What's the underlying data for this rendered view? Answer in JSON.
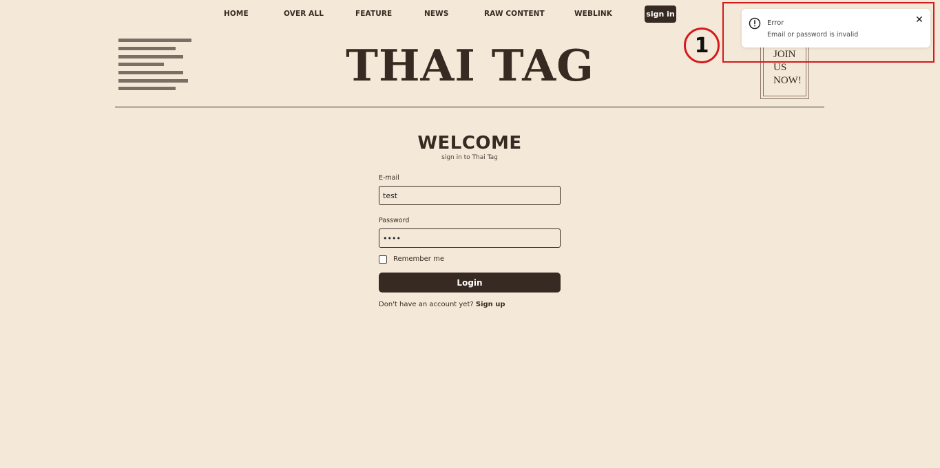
{
  "nav": {
    "items": [
      "HOME",
      "OVER ALL",
      "FEATURE",
      "NEWS",
      "RAW CONTENT",
      "WEBLINK"
    ],
    "signin_label": "sign in"
  },
  "header": {
    "logo": "THAI TAG",
    "join_card": "JOIN\nUS\nNOW!"
  },
  "form": {
    "title": "WELCOME",
    "subtitle": "sign in to Thai Tag",
    "email_label": "E-mail",
    "email_value": "test",
    "password_label": "Password",
    "password_value": "••••",
    "remember_label": "Remember me",
    "login_label": "Login",
    "signup_prompt": "Don't have an account yet?",
    "signup_link": "Sign up"
  },
  "toast": {
    "title": "Error",
    "message": "Email or password is invalid",
    "close_glyph": "✕",
    "icon": "alert-circle-icon"
  },
  "annotation": {
    "number": "1",
    "color": "#d41a1a"
  },
  "colors": {
    "background": "#f4e8d8",
    "brand": "#372a22",
    "error_highlight": "#d41a1a"
  }
}
